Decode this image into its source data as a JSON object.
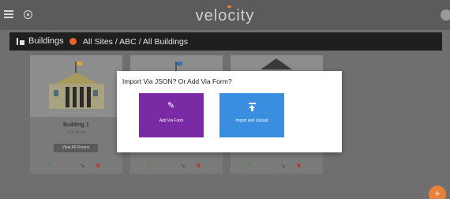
{
  "app": {
    "logo": "velocity"
  },
  "breadcrumb": {
    "title": "Buildings",
    "path": "All Sites / ABC / All Buildings"
  },
  "cards": [
    {
      "title": "Building 1",
      "zone": "333 Street",
      "view_button": "View All Rooms"
    }
  ],
  "modal": {
    "title": "Import Via JSON? Or Add Via Form?",
    "option_form": "Add Via Form",
    "option_json": "Import and Upload"
  },
  "fab": {
    "label": "+"
  },
  "colors": {
    "topbar": "#5b5b5b",
    "form_option": "#7b2aa6",
    "json_option": "#3a8ee0",
    "accent": "#e8813a"
  }
}
